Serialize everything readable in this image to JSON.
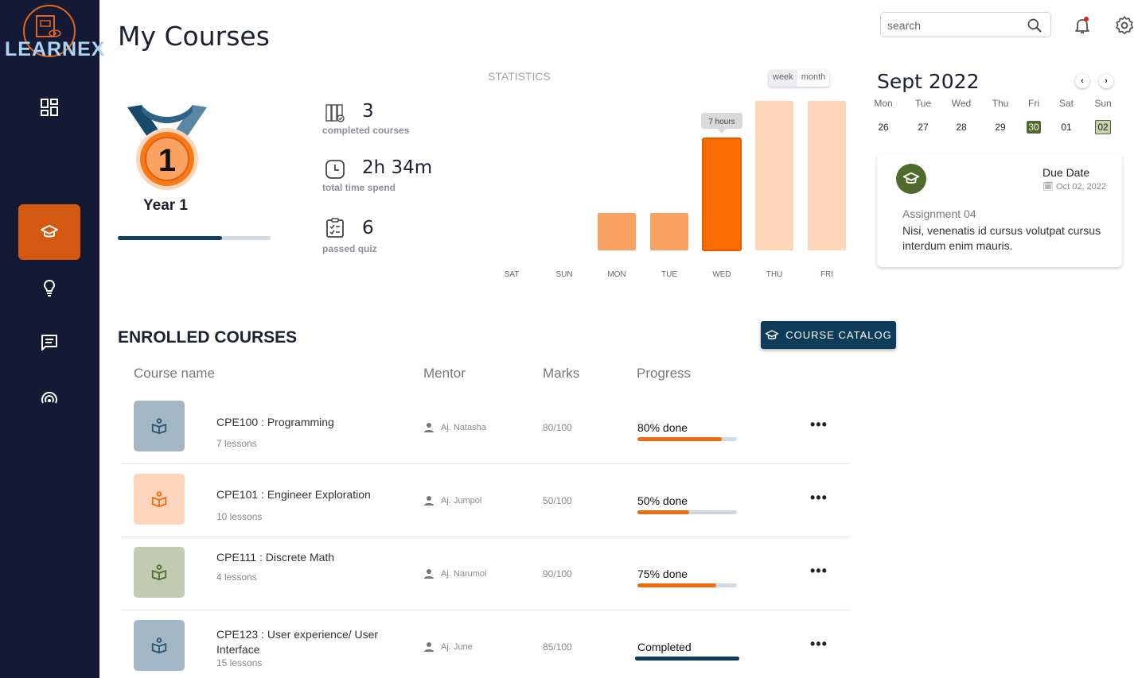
{
  "app": {
    "logo_text": "LEARNEX"
  },
  "header": {
    "title": "My Courses",
    "search_placeholder": "search"
  },
  "sidebar": {
    "items": [
      {
        "name": "dashboard",
        "icon": "dashboard-icon",
        "active": false
      },
      {
        "name": "courses",
        "icon": "graduation-cap-icon",
        "active": true
      },
      {
        "name": "ideas",
        "icon": "lightbulb-icon",
        "active": false
      },
      {
        "name": "messages",
        "icon": "chat-icon",
        "active": false
      },
      {
        "name": "broadcast",
        "icon": "signal-icon",
        "active": false
      }
    ]
  },
  "profile": {
    "medal_number": "1",
    "year_label": "Year 1",
    "year_progress": 0.68
  },
  "stats": [
    {
      "value": "3",
      "label": "completed courses",
      "icon": "books-icon"
    },
    {
      "value": "2h 34m",
      "label": "total time spend",
      "icon": "clock-icon"
    },
    {
      "value": "6",
      "label": "passed quiz",
      "icon": "clipboard-icon"
    }
  ],
  "statistics": {
    "title": "STATISTICS",
    "toggle": {
      "week": "week",
      "month": "month",
      "active": "week"
    }
  },
  "chart_data": {
    "type": "bar",
    "categories": [
      "SAT",
      "SUN",
      "MON",
      "TUE",
      "WED",
      "THU",
      "FRI"
    ],
    "values": [
      0,
      0,
      2,
      2,
      6,
      8,
      8
    ],
    "ylim": [
      0,
      8
    ],
    "tooltip": {
      "category": "WED",
      "text": "7 hours"
    },
    "colors": {
      "past": "#f9a262",
      "highlight": "#fa6b00",
      "future": "#fdd5b8"
    },
    "highlight_index": 4,
    "future_from_index": 5,
    "grid": false
  },
  "calendar": {
    "title": "Sept 2022",
    "days": [
      "Mon",
      "Tue",
      "Wed",
      "Thu",
      "Fri",
      "Sat",
      "Sun"
    ],
    "dates": [
      "26",
      "27",
      "28",
      "29",
      "30",
      "01",
      "02"
    ],
    "today_index": 4,
    "due_index": 6
  },
  "due": {
    "label": "Due Date",
    "date": "Oct 02, 2022",
    "title": "Assignment 04",
    "description": "Nisi, venenatis id cursus volutpat cursus interdum enim mauris."
  },
  "enrolled": {
    "title": "ENROLLED COURSES",
    "catalog_button": "COURSE CATALOG",
    "columns": {
      "name": "Course name",
      "mentor": "Mentor",
      "marks": "Marks",
      "progress": "Progress"
    },
    "rows": [
      {
        "name": "CPE100 : Programming",
        "lessons": "7 lessons",
        "mentor": "Aj. Natasha",
        "marks": "80/100",
        "progress_label": "80% done",
        "progress": 0.85,
        "thumb_color": "#a3b8c6",
        "icon_color": "#2c5472",
        "completed": false
      },
      {
        "name": "CPE101 : Engineer Exploration",
        "lessons": "10 lessons",
        "mentor": "Aj. Jumpol",
        "marks": "50/100",
        "progress_label": "50% done",
        "progress": 0.52,
        "thumb_color": "#fdd5bd",
        "icon_color": "#f06a0f",
        "completed": false
      },
      {
        "name": "CPE111 : Discrete Math",
        "lessons": "4 lessons",
        "mentor": "Aj. Narumol",
        "marks": "90/100",
        "progress_label": "75% done",
        "progress": 0.79,
        "thumb_color": "#c2cab0",
        "icon_color": "#556b34",
        "completed": false
      },
      {
        "name": "CPE123 : User experience/ User Interface",
        "lessons": "15 lessons",
        "mentor": "Aj. June",
        "marks": "85/100",
        "progress_label": "Completed",
        "progress": 1.0,
        "thumb_color": "#a3b8c6",
        "icon_color": "#2c5472",
        "completed": true
      }
    ]
  }
}
